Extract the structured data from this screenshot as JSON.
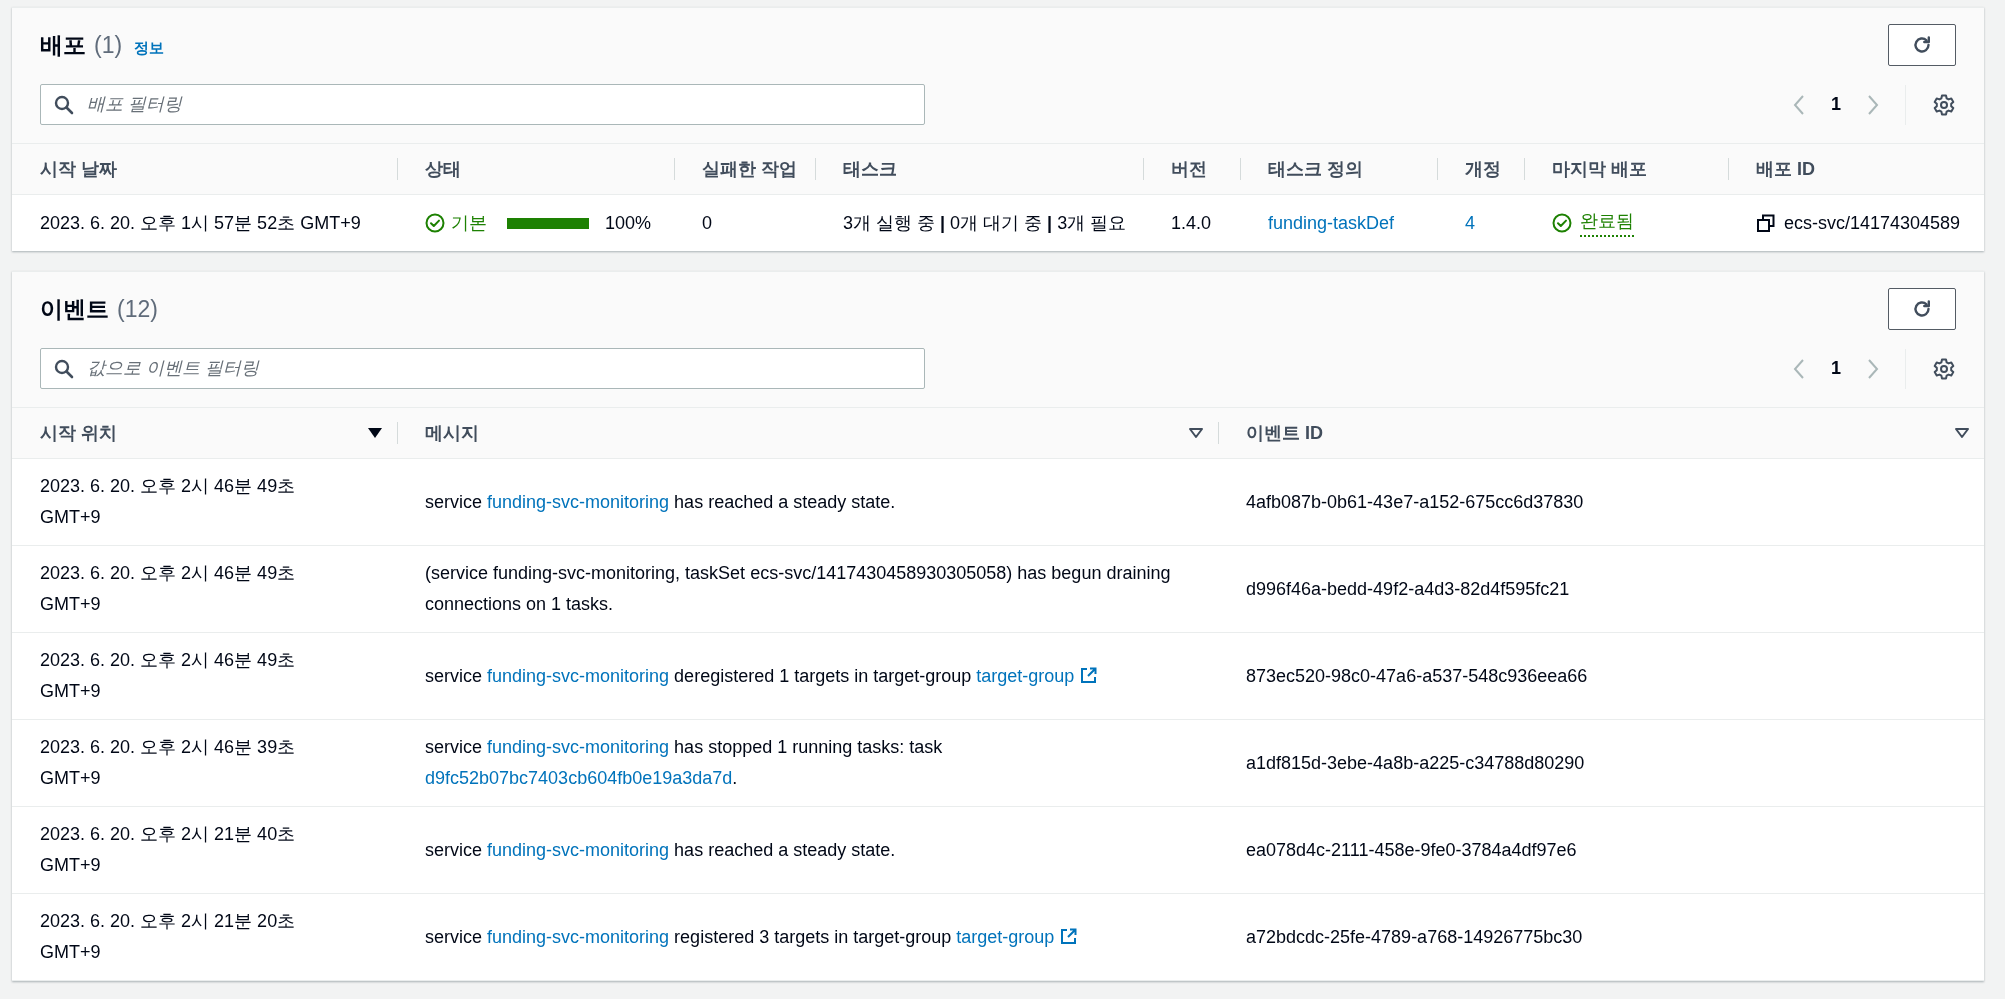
{
  "deployments": {
    "title": "배포",
    "count": "(1)",
    "info_link": "정보",
    "search": {
      "placeholder": "배포 필터링"
    },
    "pagination": {
      "page": "1",
      "prev_disabled": true,
      "next_disabled": true
    },
    "columns": [
      "시작 날짜",
      "상태",
      "실패한 작업",
      "태스크",
      "버전",
      "태스크 정의",
      "개정",
      "마지막 배포",
      "배포 ID"
    ],
    "rows": [
      {
        "start_date": "2023. 6. 20. 오후 1시 57분 52초 GMT+9",
        "status": {
          "label": "기본",
          "level": 1,
          "percent": "100%"
        },
        "failed_tasks": "0",
        "tasks": "3개 실행 중 **|** 0개 대기 중 **|** 3개 필요",
        "version": "1.4.0",
        "task_definition": "funding-taskDef",
        "revision": "4",
        "last_deployment": "완료됨",
        "deployment_id": "ecs-svc/14174304589"
      }
    ]
  },
  "events": {
    "title": "이벤트",
    "count": "(12)",
    "search": {
      "placeholder": "값으로 이벤트 필터링"
    },
    "pagination": {
      "page": "1",
      "prev_disabled": true,
      "next_disabled": true
    },
    "columns": [
      {
        "label": "시작 위치",
        "sorted": true
      },
      {
        "label": "메시지",
        "sorted": false
      },
      {
        "label": "이벤트 ID",
        "sorted": false
      }
    ],
    "rows": [
      {
        "time": "2023. 6. 20. 오후 2시 46분 49초 GMT+9",
        "message": [
          {
            "text": "service ",
            "kind": "text"
          },
          {
            "text": "funding-svc-monitoring",
            "kind": "link"
          },
          {
            "text": " has reached a steady state.",
            "kind": "text"
          }
        ],
        "event_id": "4afb087b-0b61-43e7-a152-675cc6d37830"
      },
      {
        "time": "2023. 6. 20. 오후 2시 46분 49초 GMT+9",
        "message": [
          {
            "text": "(service funding-svc-monitoring, taskSet ecs-svc/1417430458930305058) has begun draining connections on 1 tasks.",
            "kind": "text"
          }
        ],
        "event_id": "d996f46a-bedd-49f2-a4d3-82d4f595fc21"
      },
      {
        "time": "2023. 6. 20. 오후 2시 46분 49초 GMT+9",
        "message": [
          {
            "text": "service ",
            "kind": "text"
          },
          {
            "text": "funding-svc-monitoring",
            "kind": "link"
          },
          {
            "text": " deregistered 1 targets in target-group ",
            "kind": "text"
          },
          {
            "text": "target-group",
            "kind": "external_link"
          }
        ],
        "event_id": "873ec520-98c0-47a6-a537-548c936eea66"
      },
      {
        "time": "2023. 6. 20. 오후 2시 46분 39초 GMT+9",
        "message": [
          {
            "text": "service ",
            "kind": "text"
          },
          {
            "text": "funding-svc-monitoring",
            "kind": "link"
          },
          {
            "text": " has stopped 1 running tasks: task ",
            "kind": "text"
          },
          {
            "text": "d9fc52b07bc7403cb604fb0e19a3da7d",
            "kind": "link"
          },
          {
            "text": ".",
            "kind": "text"
          }
        ],
        "event_id": "a1df815d-3ebe-4a8b-a225-c34788d80290"
      },
      {
        "time": "2023. 6. 20. 오후 2시 21분 40초 GMT+9",
        "message": [
          {
            "text": "service ",
            "kind": "text"
          },
          {
            "text": "funding-svc-monitoring",
            "kind": "link"
          },
          {
            "text": " has reached a steady state.",
            "kind": "text"
          }
        ],
        "event_id": "ea078d4c-2111-458e-9fe0-3784a4df97e6"
      },
      {
        "time": "2023. 6. 20. 오후 2시 21분 20초 GMT+9",
        "message": [
          {
            "text": "service ",
            "kind": "text"
          },
          {
            "text": "funding-svc-monitoring",
            "kind": "link"
          },
          {
            "text": " registered 3 targets in target-group ",
            "kind": "text"
          },
          {
            "text": "target-group",
            "kind": "external_link"
          }
        ],
        "event_id": "a72bdcdc-25fe-4789-a768-14926775bc30"
      }
    ]
  }
}
